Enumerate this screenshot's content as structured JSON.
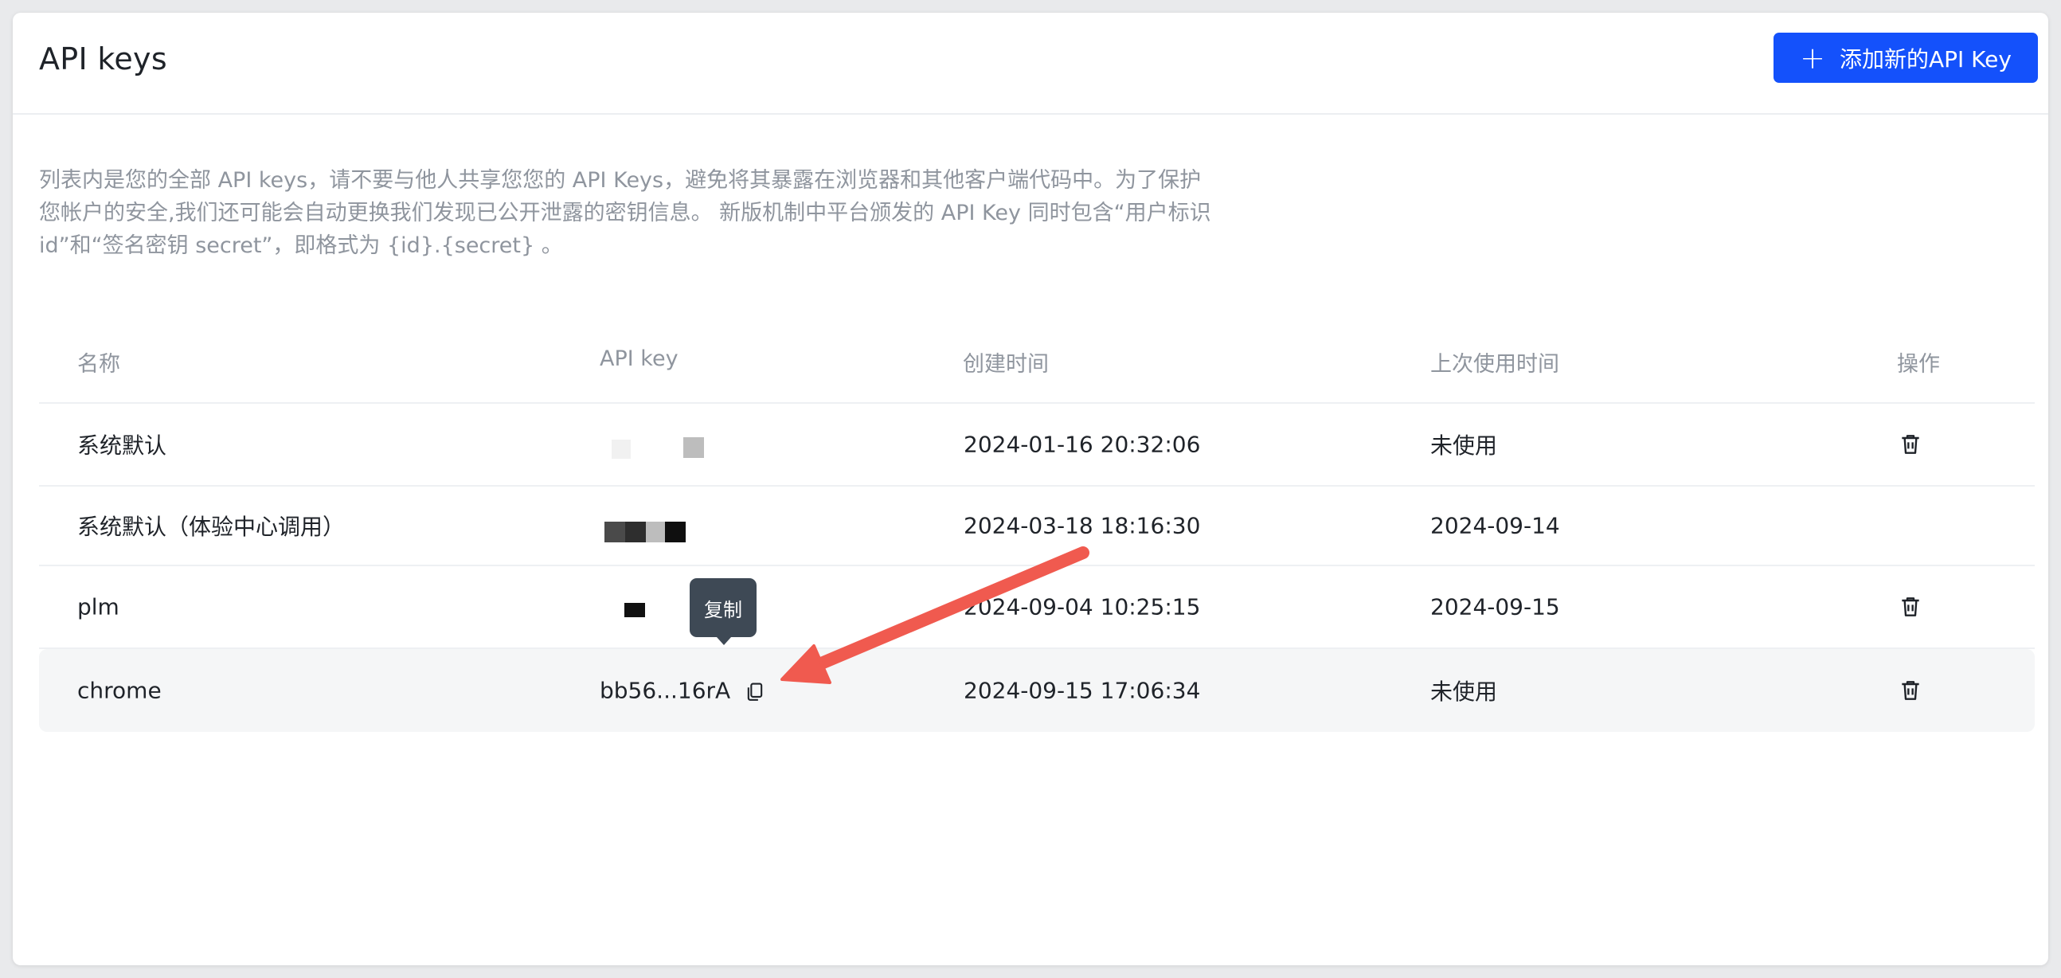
{
  "header": {
    "title": "API keys",
    "add_button_label": "添加新的API Key",
    "add_icon": "plus-icon"
  },
  "description": "列表内是您的全部 API keys，请不要与他人共享您您的 API Keys，避免将其暴露在浏览器和其他客户端代码中。为了保护您帐户的安全,我们还可能会自动更换我们发现已公开泄露的密钥信息。 新版机制中平台颁发的 API Key 同时包含“用户标识 id”和“签名密钥 secret”，即格式为 {id}.{secret} 。",
  "table": {
    "columns": [
      "名称",
      "API key",
      "创建时间",
      "上次使用时间",
      "操作"
    ],
    "rows": [
      {
        "name": "系统默认",
        "api_key": "",
        "created": "2024-01-16 20:32:06",
        "last_used": "未使用",
        "has_delete": true
      },
      {
        "name": "系统默认（体验中心调用）",
        "api_key": "",
        "created": "2024-03-18 18:16:30",
        "last_used": "2024-09-14",
        "has_delete": false
      },
      {
        "name": "plm",
        "api_key": "",
        "created": "2024-09-04 10:25:15",
        "last_used": "2024-09-15",
        "has_delete": true
      },
      {
        "name": "chrome",
        "api_key": "bb56...16rA",
        "created": "2024-09-15 17:06:34",
        "last_used": "未使用",
        "has_delete": true
      }
    ]
  },
  "tooltip": {
    "label": "复制"
  },
  "icons": {
    "delete": "trash-icon",
    "copy": "copy-icon"
  },
  "colors": {
    "primary": "#1451fb",
    "annotation_arrow": "#f05a4f",
    "tooltip_bg": "#3e4955"
  }
}
